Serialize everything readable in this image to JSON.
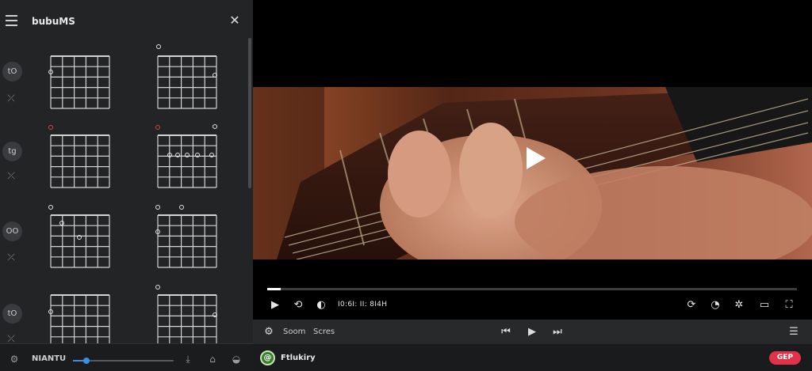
{
  "panel": {
    "title": "bubuMS",
    "close_label": "✕"
  },
  "rail": [
    {
      "label": "tO",
      "icon": "shuffle-icon"
    },
    {
      "label": "tg",
      "icon": "shuffle-icon"
    },
    {
      "label": "OO",
      "icon": "shuffle-icon"
    },
    {
      "label": "tO",
      "icon": "shuffle-icon"
    }
  ],
  "footer": {
    "label": "NIANTU",
    "volume_fraction": 0.13
  },
  "video": {
    "progress_fraction": 0.025,
    "time_text": "I0:6I: II: 8I4H"
  },
  "transport": {
    "label_1": "Soom",
    "label_2": "Scres"
  },
  "bottom": {
    "logo_text": "@",
    "app_name": "Ftlukiry",
    "pill_text": "GEP"
  },
  "colors": {
    "accent": "#3a8ee6",
    "brand_red": "#e0324a",
    "panel_bg": "#232426"
  }
}
